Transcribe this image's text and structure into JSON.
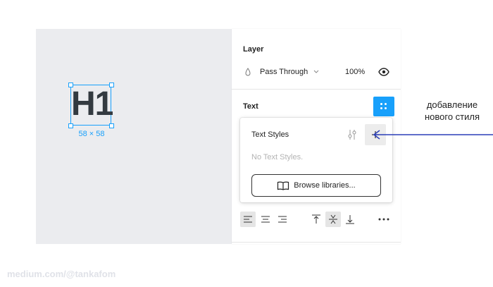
{
  "canvas": {
    "frame_text": "H1",
    "dimensions": "58 × 58"
  },
  "layer": {
    "title": "Layer",
    "blend_mode": "Pass Through",
    "opacity": "100%",
    "icons": [
      "blend-drop-icon",
      "chevron-down-icon",
      "eye-icon"
    ]
  },
  "text_section": {
    "title": "Text",
    "styles_button_icon": "four-dots-icon"
  },
  "text_styles_popup": {
    "title": "Text Styles",
    "empty_text": "No Text Styles.",
    "browse_label": "Browse libraries...",
    "icons": [
      "adjust-sliders-icon",
      "plus-icon",
      "book-icon"
    ]
  },
  "alignment": {
    "horizontal": [
      "align-left",
      "align-center",
      "align-right"
    ],
    "horizontal_selected": "align-left",
    "vertical": [
      "align-top",
      "align-middle",
      "align-bottom"
    ],
    "vertical_selected": "align-middle",
    "more_icon": "more-icon"
  },
  "annotation": {
    "text": "добавление нового стиля",
    "arrow_color": "#2b3fb8"
  },
  "watermark": "medium.com/@tankafom",
  "colors": {
    "accent": "#18a0fb",
    "canvas_bg": "#ebecef"
  }
}
